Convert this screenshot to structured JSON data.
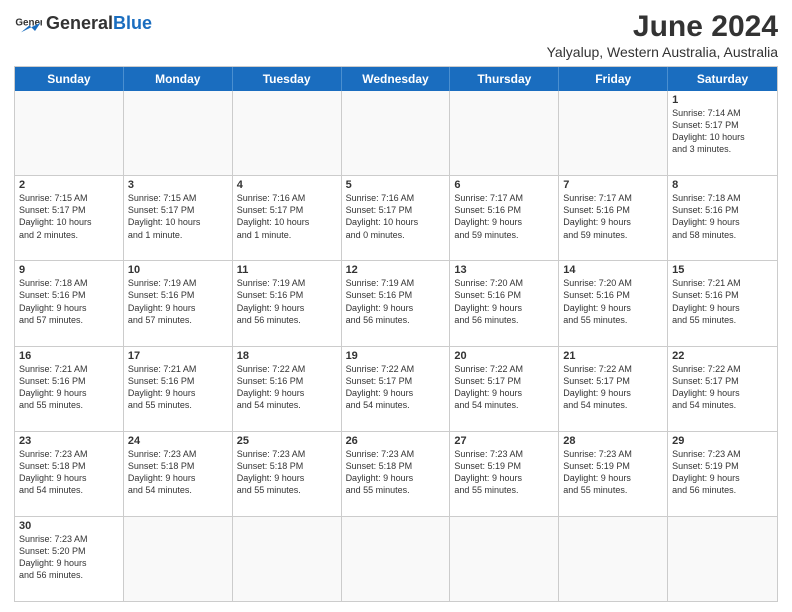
{
  "header": {
    "logo_general": "General",
    "logo_blue": "Blue",
    "title": "June 2024",
    "subtitle": "Yalyalup, Western Australia, Australia"
  },
  "days_of_week": [
    "Sunday",
    "Monday",
    "Tuesday",
    "Wednesday",
    "Thursday",
    "Friday",
    "Saturday"
  ],
  "weeks": [
    [
      {
        "day": "",
        "info": ""
      },
      {
        "day": "",
        "info": ""
      },
      {
        "day": "",
        "info": ""
      },
      {
        "day": "",
        "info": ""
      },
      {
        "day": "",
        "info": ""
      },
      {
        "day": "",
        "info": ""
      },
      {
        "day": "1",
        "info": "Sunrise: 7:14 AM\nSunset: 5:17 PM\nDaylight: 10 hours\nand 3 minutes."
      }
    ],
    [
      {
        "day": "2",
        "info": "Sunrise: 7:15 AM\nSunset: 5:17 PM\nDaylight: 10 hours\nand 2 minutes."
      },
      {
        "day": "3",
        "info": "Sunrise: 7:15 AM\nSunset: 5:17 PM\nDaylight: 10 hours\nand 1 minute."
      },
      {
        "day": "4",
        "info": "Sunrise: 7:16 AM\nSunset: 5:17 PM\nDaylight: 10 hours\nand 1 minute."
      },
      {
        "day": "5",
        "info": "Sunrise: 7:16 AM\nSunset: 5:17 PM\nDaylight: 10 hours\nand 0 minutes."
      },
      {
        "day": "6",
        "info": "Sunrise: 7:17 AM\nSunset: 5:16 PM\nDaylight: 9 hours\nand 59 minutes."
      },
      {
        "day": "7",
        "info": "Sunrise: 7:17 AM\nSunset: 5:16 PM\nDaylight: 9 hours\nand 59 minutes."
      },
      {
        "day": "8",
        "info": "Sunrise: 7:18 AM\nSunset: 5:16 PM\nDaylight: 9 hours\nand 58 minutes."
      }
    ],
    [
      {
        "day": "9",
        "info": "Sunrise: 7:18 AM\nSunset: 5:16 PM\nDaylight: 9 hours\nand 57 minutes."
      },
      {
        "day": "10",
        "info": "Sunrise: 7:19 AM\nSunset: 5:16 PM\nDaylight: 9 hours\nand 57 minutes."
      },
      {
        "day": "11",
        "info": "Sunrise: 7:19 AM\nSunset: 5:16 PM\nDaylight: 9 hours\nand 56 minutes."
      },
      {
        "day": "12",
        "info": "Sunrise: 7:19 AM\nSunset: 5:16 PM\nDaylight: 9 hours\nand 56 minutes."
      },
      {
        "day": "13",
        "info": "Sunrise: 7:20 AM\nSunset: 5:16 PM\nDaylight: 9 hours\nand 56 minutes."
      },
      {
        "day": "14",
        "info": "Sunrise: 7:20 AM\nSunset: 5:16 PM\nDaylight: 9 hours\nand 55 minutes."
      },
      {
        "day": "15",
        "info": "Sunrise: 7:21 AM\nSunset: 5:16 PM\nDaylight: 9 hours\nand 55 minutes."
      }
    ],
    [
      {
        "day": "16",
        "info": "Sunrise: 7:21 AM\nSunset: 5:16 PM\nDaylight: 9 hours\nand 55 minutes."
      },
      {
        "day": "17",
        "info": "Sunrise: 7:21 AM\nSunset: 5:16 PM\nDaylight: 9 hours\nand 55 minutes."
      },
      {
        "day": "18",
        "info": "Sunrise: 7:22 AM\nSunset: 5:16 PM\nDaylight: 9 hours\nand 54 minutes."
      },
      {
        "day": "19",
        "info": "Sunrise: 7:22 AM\nSunset: 5:17 PM\nDaylight: 9 hours\nand 54 minutes."
      },
      {
        "day": "20",
        "info": "Sunrise: 7:22 AM\nSunset: 5:17 PM\nDaylight: 9 hours\nand 54 minutes."
      },
      {
        "day": "21",
        "info": "Sunrise: 7:22 AM\nSunset: 5:17 PM\nDaylight: 9 hours\nand 54 minutes."
      },
      {
        "day": "22",
        "info": "Sunrise: 7:22 AM\nSunset: 5:17 PM\nDaylight: 9 hours\nand 54 minutes."
      }
    ],
    [
      {
        "day": "23",
        "info": "Sunrise: 7:23 AM\nSunset: 5:18 PM\nDaylight: 9 hours\nand 54 minutes."
      },
      {
        "day": "24",
        "info": "Sunrise: 7:23 AM\nSunset: 5:18 PM\nDaylight: 9 hours\nand 54 minutes."
      },
      {
        "day": "25",
        "info": "Sunrise: 7:23 AM\nSunset: 5:18 PM\nDaylight: 9 hours\nand 55 minutes."
      },
      {
        "day": "26",
        "info": "Sunrise: 7:23 AM\nSunset: 5:18 PM\nDaylight: 9 hours\nand 55 minutes."
      },
      {
        "day": "27",
        "info": "Sunrise: 7:23 AM\nSunset: 5:19 PM\nDaylight: 9 hours\nand 55 minutes."
      },
      {
        "day": "28",
        "info": "Sunrise: 7:23 AM\nSunset: 5:19 PM\nDaylight: 9 hours\nand 55 minutes."
      },
      {
        "day": "29",
        "info": "Sunrise: 7:23 AM\nSunset: 5:19 PM\nDaylight: 9 hours\nand 56 minutes."
      }
    ],
    [
      {
        "day": "30",
        "info": "Sunrise: 7:23 AM\nSunset: 5:20 PM\nDaylight: 9 hours\nand 56 minutes."
      },
      {
        "day": "",
        "info": ""
      },
      {
        "day": "",
        "info": ""
      },
      {
        "day": "",
        "info": ""
      },
      {
        "day": "",
        "info": ""
      },
      {
        "day": "",
        "info": ""
      },
      {
        "day": "",
        "info": ""
      }
    ]
  ]
}
